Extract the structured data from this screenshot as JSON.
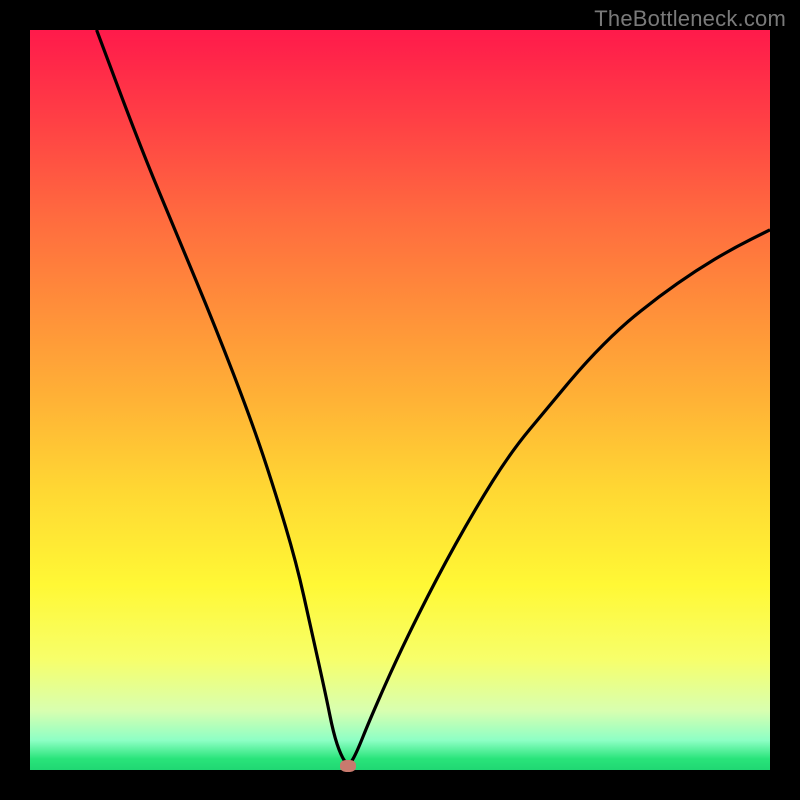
{
  "watermark": "TheBottleneck.com",
  "colors": {
    "frame_bg": "#000000",
    "gradient_top": "#ff1a4b",
    "gradient_bottom": "#20d773",
    "curve_stroke": "#000000",
    "marker_fill": "#c97a6e"
  },
  "chart_data": {
    "type": "line",
    "title": "",
    "xlabel": "",
    "ylabel": "",
    "xlim": [
      0,
      100
    ],
    "ylim": [
      0,
      100
    ],
    "legend": [],
    "grid": false,
    "annotations": [],
    "series": [
      {
        "name": "curve",
        "x": [
          9,
          15,
          20,
          25,
          30,
          33,
          36,
          38,
          40,
          41,
          42,
          43,
          44,
          46,
          50,
          55,
          60,
          65,
          70,
          75,
          80,
          85,
          90,
          95,
          100
        ],
        "y": [
          100,
          84,
          72,
          60,
          47,
          38,
          28,
          19,
          10,
          5,
          2,
          0.5,
          2,
          7,
          16,
          26,
          35,
          43,
          49,
          55,
          60,
          64,
          67.5,
          70.5,
          73
        ]
      }
    ],
    "marker": {
      "x": 43,
      "y": 0.5
    }
  }
}
